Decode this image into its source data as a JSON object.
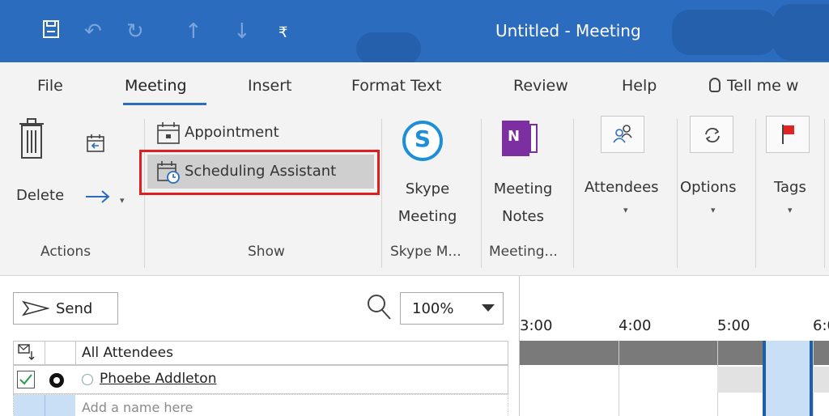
{
  "window": {
    "title": "Untitled - Meeting"
  },
  "quick_access": {
    "save_icon": "floppy-disk-icon",
    "undo_icon": "undo-icon",
    "redo_icon": "redo-icon",
    "up_icon": "up-arrow-icon",
    "down_icon": "down-arrow-icon",
    "customize_icon": "customize-qat-icon"
  },
  "menu": {
    "tabs": [
      {
        "label": "File"
      },
      {
        "label": "Meeting"
      },
      {
        "label": "Insert"
      },
      {
        "label": "Format Text"
      },
      {
        "label": "Review"
      },
      {
        "label": "Help"
      },
      {
        "label": "Tell me w"
      }
    ]
  },
  "ribbon": {
    "actions": {
      "delete_label": "Delete",
      "group_label": "Actions"
    },
    "show": {
      "appointment_label": "Appointment",
      "scheduling_label": "Scheduling Assistant",
      "group_label": "Show"
    },
    "skype": {
      "button_line1": "Skype",
      "button_line2": "Meeting",
      "group_label": "Skype M..."
    },
    "notes": {
      "button_line1": "Meeting",
      "button_line2": "Notes",
      "group_label": "Meeting..."
    },
    "attendees_label": "Attendees",
    "options_label": "Options",
    "tags_label": "Tags",
    "onenote_icon_text": "N"
  },
  "scheduling": {
    "send_label": "Send",
    "zoom_value": "100%",
    "header_all_attendees": "All Attendees",
    "attendee_name": "Phoebe Addleton",
    "add_placeholder": "Add a name here",
    "times": [
      "3:00",
      "4:00",
      "5:00",
      "6:0"
    ]
  },
  "colors": {
    "titlebar": "#2b6cbf",
    "highlight_border": "#e01e1e",
    "selection": "#c9dff5"
  }
}
